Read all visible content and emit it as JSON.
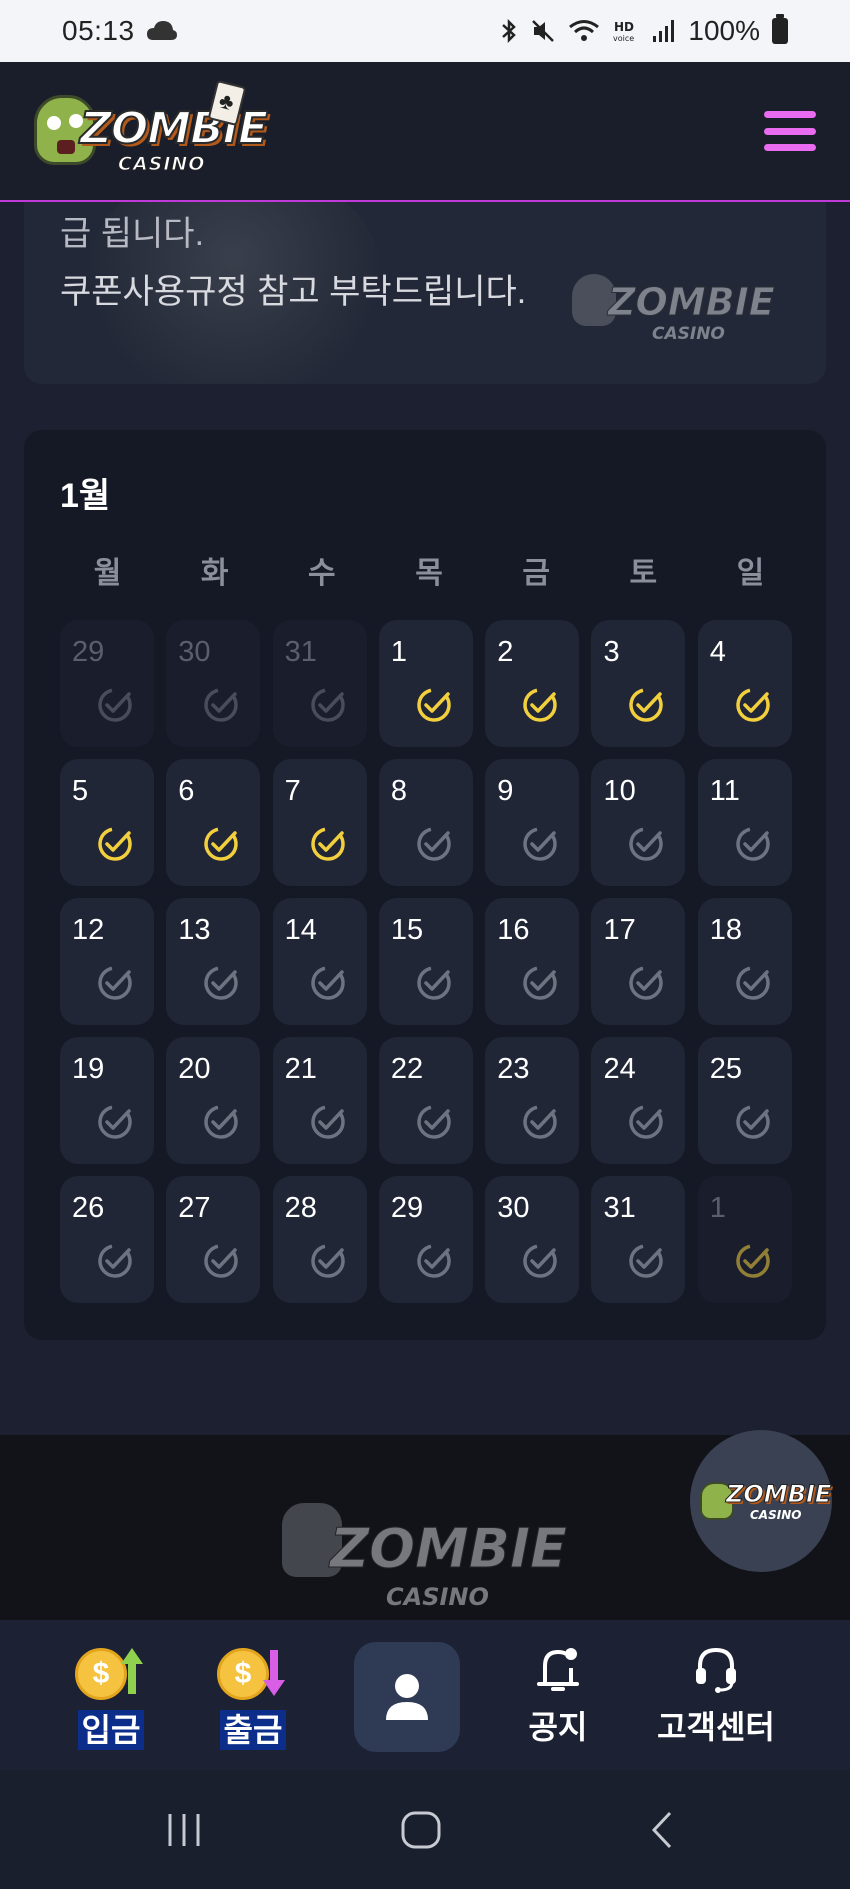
{
  "status_bar": {
    "time": "05:13",
    "battery": "100%"
  },
  "brand": {
    "logo_word": "ZOMBIE",
    "logo_sub": "CASINO"
  },
  "notice": {
    "line1": "급 됩니다.",
    "line2": "쿠폰사용규정 참고 부탁드립니다."
  },
  "calendar": {
    "month_label": "1월",
    "weekdays": [
      "월",
      "화",
      "수",
      "목",
      "금",
      "토",
      "일"
    ],
    "days": [
      {
        "n": "29",
        "state": "muted",
        "checked": false
      },
      {
        "n": "30",
        "state": "muted",
        "checked": false
      },
      {
        "n": "31",
        "state": "muted",
        "checked": false
      },
      {
        "n": "1",
        "state": "current",
        "checked": true
      },
      {
        "n": "2",
        "state": "current",
        "checked": true
      },
      {
        "n": "3",
        "state": "current",
        "checked": true
      },
      {
        "n": "4",
        "state": "current",
        "checked": true
      },
      {
        "n": "5",
        "state": "current",
        "checked": true
      },
      {
        "n": "6",
        "state": "current",
        "checked": true
      },
      {
        "n": "7",
        "state": "current",
        "checked": true
      },
      {
        "n": "8",
        "state": "current",
        "checked": false
      },
      {
        "n": "9",
        "state": "current",
        "checked": false
      },
      {
        "n": "10",
        "state": "current",
        "checked": false
      },
      {
        "n": "11",
        "state": "current",
        "checked": false
      },
      {
        "n": "12",
        "state": "current",
        "checked": false
      },
      {
        "n": "13",
        "state": "current",
        "checked": false
      },
      {
        "n": "14",
        "state": "current",
        "checked": false
      },
      {
        "n": "15",
        "state": "current",
        "checked": false
      },
      {
        "n": "16",
        "state": "current",
        "checked": false
      },
      {
        "n": "17",
        "state": "current",
        "checked": false
      },
      {
        "n": "18",
        "state": "current",
        "checked": false
      },
      {
        "n": "19",
        "state": "current",
        "checked": false
      },
      {
        "n": "20",
        "state": "current",
        "checked": false
      },
      {
        "n": "21",
        "state": "current",
        "checked": false
      },
      {
        "n": "22",
        "state": "current",
        "checked": false
      },
      {
        "n": "23",
        "state": "current",
        "checked": false
      },
      {
        "n": "24",
        "state": "current",
        "checked": false
      },
      {
        "n": "25",
        "state": "current",
        "checked": false
      },
      {
        "n": "26",
        "state": "current",
        "checked": false
      },
      {
        "n": "27",
        "state": "current",
        "checked": false
      },
      {
        "n": "28",
        "state": "current",
        "checked": false
      },
      {
        "n": "29",
        "state": "current",
        "checked": false
      },
      {
        "n": "30",
        "state": "current",
        "checked": false
      },
      {
        "n": "31",
        "state": "current",
        "checked": false
      },
      {
        "n": "1",
        "state": "next",
        "checked": true
      }
    ]
  },
  "bottom_nav": {
    "deposit": "입금",
    "withdraw": "출금",
    "notice": "공지",
    "support": "고객센터"
  },
  "colors": {
    "accent": "#e86bf0",
    "check_active": "#f2cf3c",
    "check_inactive": "#6e7382",
    "card_bg": "#151925",
    "cell_bg": "#212637"
  }
}
